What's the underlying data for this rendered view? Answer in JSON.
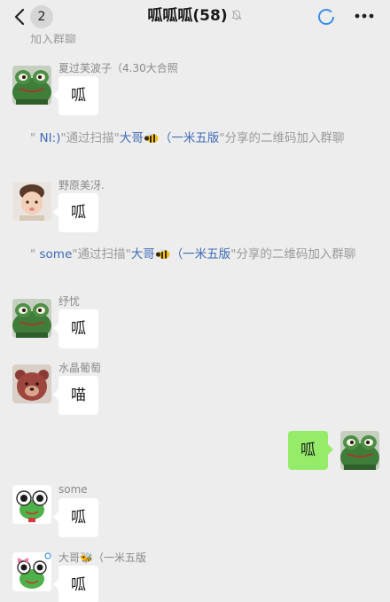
{
  "header": {
    "back_count": "2",
    "title": "呱呱呱",
    "member_count": "(58)"
  },
  "ghost_top": "加入群聊",
  "messages": [
    {
      "sender": "夏过芙波子（4.30大合照",
      "text": "呱"
    },
    {
      "sender": "野原美冴.",
      "text": "呱"
    },
    {
      "sender": "纾忧",
      "text": "呱"
    },
    {
      "sender": "水晶葡萄",
      "text": "喵"
    },
    {
      "sender": "",
      "text": "呱"
    },
    {
      "sender": "some",
      "text": "呱"
    },
    {
      "sender": "大哥🐝（一米五版",
      "text": "呱"
    }
  ],
  "system_1": {
    "q1": "\"",
    "name": " NI:)",
    "mid": "\"通过扫描\"",
    "inviter": "大哥",
    "inviter2": "（一米五版",
    "tail": "\"分享的二维码加入群聊"
  },
  "system_2": {
    "q1": "\"",
    "name": " some",
    "mid": "\"通过扫描\"",
    "inviter": "大哥",
    "inviter2": "（一米五版",
    "tail": "\"分享的二维码加入群聊"
  },
  "colors": {
    "background": "#ededed",
    "my_bubble": "#95ec69",
    "link": "#3f6bb5"
  }
}
